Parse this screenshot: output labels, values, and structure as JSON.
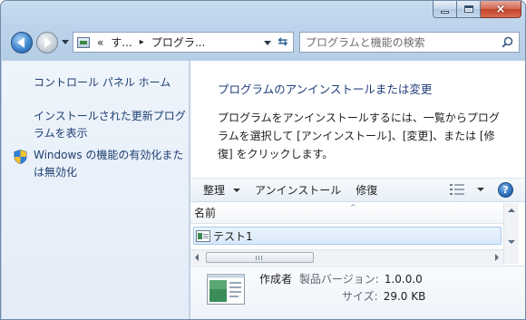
{
  "window": {
    "caption": {
      "minimize": "minimize",
      "maximize": "maximize",
      "close": "×"
    }
  },
  "nav": {
    "address": {
      "crumb_root": "«",
      "crumb_1": "す...",
      "crumb_separator": "▸",
      "crumb_2": "プログラ..."
    },
    "refresh_label": "⇆",
    "search_placeholder": "プログラムと機能の検索"
  },
  "left_pane": {
    "control_panel_home": "コントロール パネル ホーム",
    "view_updates": "インストールされた更新プログラムを表示",
    "windows_features": "Windows の機能の有効化または無効化"
  },
  "main": {
    "title": "プログラムのアンインストールまたは変更",
    "description": "プログラムをアンインストールするには、一覧からプログラムを選択して [アンインストール]、[変更]、または [修復] をクリックします。"
  },
  "toolbar": {
    "organize": "整理",
    "uninstall": "アンインストール",
    "repair": "修復",
    "help": "?"
  },
  "list": {
    "column_name": "名前",
    "sort_arrow": "^",
    "rows": [
      {
        "label": "テスト1"
      }
    ]
  },
  "details": {
    "publisher_label": "作成者",
    "version_label": "製品バージョン:",
    "version_value": "1.0.0.0",
    "size_label": "サイズ:",
    "size_value": "29.0 KB"
  },
  "colors": {
    "link": "#1e3f72",
    "title": "#1f3d7a",
    "selection": "#d9e9fb",
    "frame": "#bcd3eb"
  },
  "icons": {
    "back": "back-arrow-icon",
    "forward": "forward-arrow-icon",
    "search": "search-icon",
    "shield": "shield-icon",
    "views": "view-list-icon",
    "help": "help-icon",
    "program": "program-icon"
  }
}
